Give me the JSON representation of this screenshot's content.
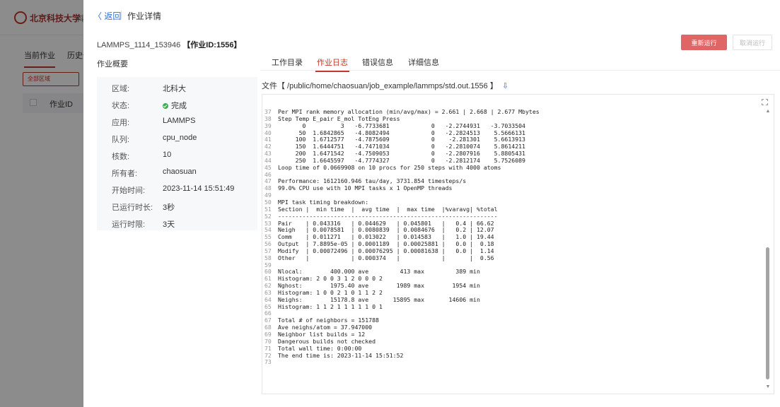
{
  "background": {
    "logo_text": "北京科技大学",
    "logo_tail": "科",
    "tabs": [
      "当前作业",
      "历史作"
    ],
    "region_button": "全部区域",
    "column_header": "作业ID"
  },
  "header": {
    "back_label": "〈 返回",
    "title": "作业详情"
  },
  "job": {
    "name": "LAMMPS_1114_153946",
    "id_label": "【作业ID:1556】"
  },
  "actions": {
    "rerun": "重新运行",
    "cancel": "取消运行"
  },
  "overview_label": "作业概要",
  "tabs": [
    {
      "label": "工作目录",
      "active": false
    },
    {
      "label": "作业日志",
      "active": true
    },
    {
      "label": "错误信息",
      "active": false
    },
    {
      "label": "详细信息",
      "active": false
    }
  ],
  "info": [
    {
      "key": "区域:",
      "value": "北科大"
    },
    {
      "key": "状态:",
      "value": "完成",
      "status_color": "#3cae4f"
    },
    {
      "key": "应用:",
      "value": "LAMMPS"
    },
    {
      "key": "队列:",
      "value": "cpu_node"
    },
    {
      "key": "核数:",
      "value": "10"
    },
    {
      "key": "所有者:",
      "value": "chaosuan"
    },
    {
      "key": "开始时间:",
      "value": "2023-11-14 15:51:49"
    },
    {
      "key": "已运行时长:",
      "value": "3秒"
    },
    {
      "key": "运行时限:",
      "value": "3天"
    }
  ],
  "file": {
    "label": "文件【 /public/home/chaosuan/job_example/lammps/std.out.1556 】",
    "download_icon": "download-icon"
  },
  "log": [
    {
      "n": "37",
      "t": "Per MPI rank memory allocation (min/avg/max) = 2.661 | 2.668 | 2.677 Mbytes"
    },
    {
      "n": "38",
      "t": "Step Temp E_pair E_mol TotEng Press"
    },
    {
      "n": "39",
      "t": "       0          3   -6.7733681            0   -2.2744931   -3.7033504"
    },
    {
      "n": "40",
      "t": "      50  1.6842865   -4.8082494            0   -2.2824513    5.5666131"
    },
    {
      "n": "41",
      "t": "     100  1.6712577   -4.7875609            0    -2.281301    5.6613913"
    },
    {
      "n": "42",
      "t": "     150  1.6444751   -4.7471034            0   -2.2810074    5.8614211"
    },
    {
      "n": "43",
      "t": "     200  1.6471542   -4.7509053            0   -2.2807916    5.8805431"
    },
    {
      "n": "44",
      "t": "     250  1.6645597   -4.7774327            0   -2.2812174    5.7526089"
    },
    {
      "n": "45",
      "t": "Loop time of 0.0669908 on 10 procs for 250 steps with 4000 atoms"
    },
    {
      "n": "46",
      "t": ""
    },
    {
      "n": "47",
      "t": "Performance: 1612160.946 tau/day, 3731.854 timesteps/s"
    },
    {
      "n": "48",
      "t": "99.0% CPU use with 10 MPI tasks x 1 OpenMP threads"
    },
    {
      "n": "49",
      "t": ""
    },
    {
      "n": "50",
      "t": "MPI task timing breakdown:"
    },
    {
      "n": "51",
      "t": "Section |  min time  |  avg time  |  max time  |%varavg| %total"
    },
    {
      "n": "52",
      "t": "---------------------------------------------------------------"
    },
    {
      "n": "53",
      "t": "Pair    | 0.043316   | 0.044629   | 0.045801   |   0.4 | 66.62"
    },
    {
      "n": "54",
      "t": "Neigh   | 0.0078581  | 0.0080839  | 0.0084676  |   0.2 | 12.07"
    },
    {
      "n": "55",
      "t": "Comm    | 0.011271   | 0.013022   | 0.014583   |   1.0 | 19.44"
    },
    {
      "n": "56",
      "t": "Output  | 7.8895e-05 | 0.0001189  | 0.00025881 |   0.0 |  0.18"
    },
    {
      "n": "57",
      "t": "Modify  | 0.00072496 | 0.00076295 | 0.00081638 |   0.0 |  1.14"
    },
    {
      "n": "58",
      "t": "Other   |            | 0.000374   |            |       |  0.56"
    },
    {
      "n": "59",
      "t": ""
    },
    {
      "n": "60",
      "t": "Nlocal:        400.000 ave         413 max         389 min"
    },
    {
      "n": "61",
      "t": "Histogram: 2 0 0 3 1 2 0 0 0 2"
    },
    {
      "n": "62",
      "t": "Nghost:        1975.40 ave        1989 max        1954 min"
    },
    {
      "n": "63",
      "t": "Histogram: 1 0 0 2 1 0 1 1 2 2"
    },
    {
      "n": "64",
      "t": "Neighs:        15178.8 ave       15895 max       14606 min"
    },
    {
      "n": "65",
      "t": "Histogram: 1 1 2 1 1 1 1 1 0 1"
    },
    {
      "n": "66",
      "t": ""
    },
    {
      "n": "67",
      "t": "Total # of neighbors = 151788"
    },
    {
      "n": "68",
      "t": "Ave neighs/atom = 37.947000"
    },
    {
      "n": "69",
      "t": "Neighbor list builds = 12"
    },
    {
      "n": "70",
      "t": "Dangerous builds not checked"
    },
    {
      "n": "71",
      "t": "Total wall time: 0:00:00"
    },
    {
      "n": "72",
      "t": "The end time is: 2023-11-14 15:51:52"
    },
    {
      "n": "73",
      "t": ""
    }
  ],
  "colors": {
    "accent": "#c0392b",
    "link": "#2f6fd6",
    "rerun_bg": "#e06565",
    "success": "#3cae4f"
  }
}
